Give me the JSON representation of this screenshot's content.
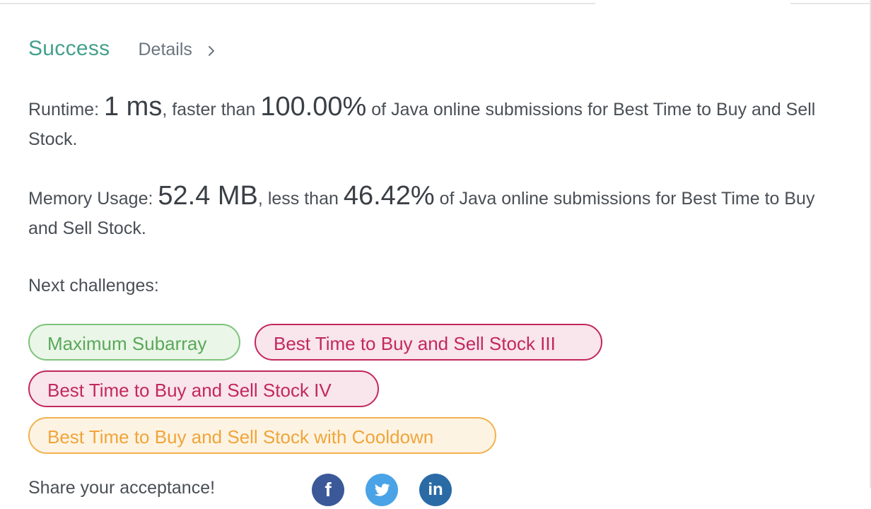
{
  "header": {
    "status": "Success",
    "details_label": "Details"
  },
  "runtime": {
    "label": "Runtime: ",
    "value": "1 ms",
    "comparison": ", faster than ",
    "percent": "100.00%",
    "suffix": " of Java online submissions for Best Time to Buy and Sell Stock."
  },
  "memory": {
    "label": "Memory Usage: ",
    "value": "52.4 MB",
    "comparison": ", less than ",
    "percent": "46.42%",
    "suffix": " of Java online submissions for Best Time to Buy and Sell Stock."
  },
  "next": {
    "label": "Next challenges:",
    "challenges": [
      {
        "title": "Maximum Subarray",
        "difficulty": "easy"
      },
      {
        "title": "Best Time to Buy and Sell Stock III",
        "difficulty": "hard"
      },
      {
        "title": "Best Time to Buy and Sell Stock IV",
        "difficulty": "hard"
      },
      {
        "title": "Best Time to Buy and Sell Stock with Cooldown",
        "difficulty": "medium"
      }
    ]
  },
  "share": {
    "label": "Share your acceptance!",
    "icons": [
      "facebook-icon",
      "twitter-icon",
      "linkedin-icon"
    ]
  },
  "colors": {
    "success": "#44a08d",
    "easy": "#5aa85a",
    "hard": "#c2285e",
    "medium": "#f0a53a"
  }
}
